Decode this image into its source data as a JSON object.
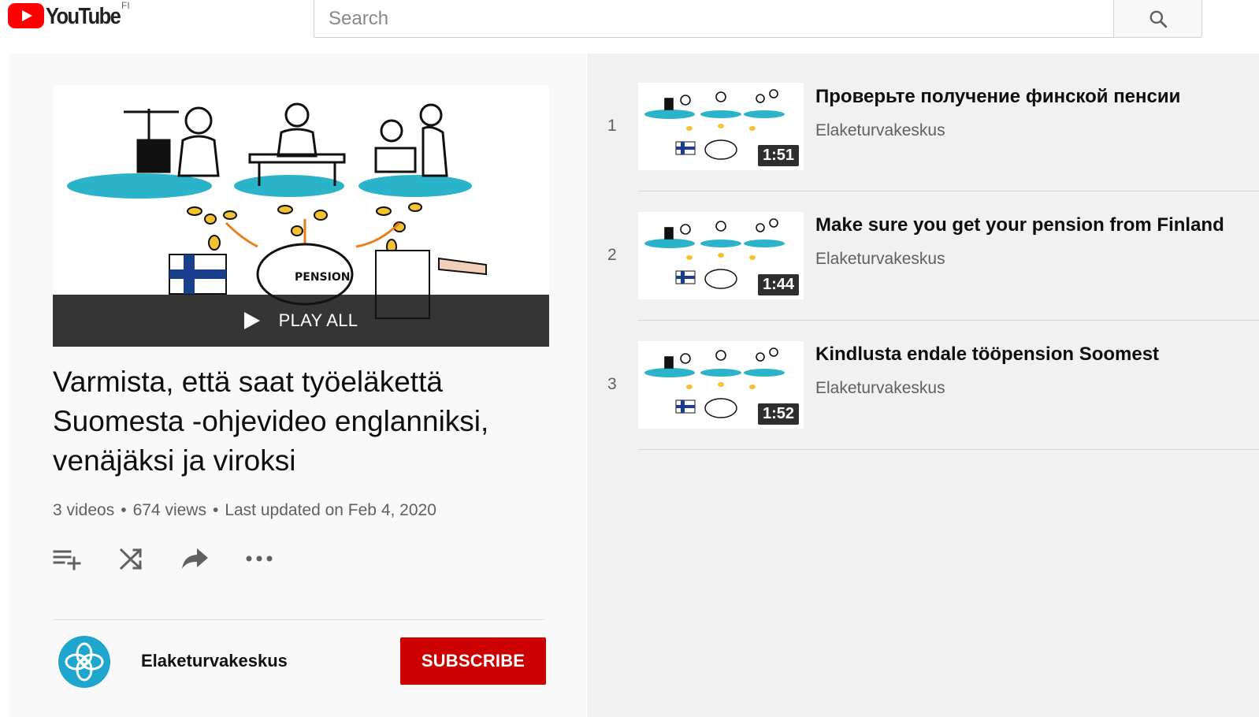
{
  "header": {
    "logo_text": "YouTube",
    "country_code": "FI",
    "search_placeholder": "Search",
    "search_icon": "search-icon"
  },
  "playlist": {
    "play_all_label": "PLAY ALL",
    "title": "Varmista, että saat työeläkettä Suomesta -ohjevideo englanniksi, venäjäksi ja viroksi",
    "video_count": "3 videos",
    "views": "674 views",
    "updated": "Last updated on Feb 4, 2020",
    "separator": "•",
    "actions": [
      {
        "name": "add-to-queue-icon"
      },
      {
        "name": "shuffle-icon"
      },
      {
        "name": "share-icon"
      },
      {
        "name": "more-icon"
      }
    ],
    "owner": {
      "name": "Elaketurvakeskus",
      "subscribe_label": "SUBSCRIBE",
      "subscribe_color": "#cc0000"
    }
  },
  "videos": [
    {
      "index": "1",
      "title": "Проверьте получение финской пенсии",
      "channel": "Elaketurvakeskus",
      "duration": "1:51"
    },
    {
      "index": "2",
      "title": "Make sure you get your pension from Finland",
      "channel": "Elaketurvakeskus",
      "duration": "1:44"
    },
    {
      "index": "3",
      "title": "Kindlusta endale tööpension Soomest",
      "channel": "Elaketurvakeskus",
      "duration": "1:52"
    }
  ],
  "colors": {
    "brand_red": "#ff0000",
    "subscribe_red": "#cc0000",
    "teal": "#2bb3c9"
  }
}
